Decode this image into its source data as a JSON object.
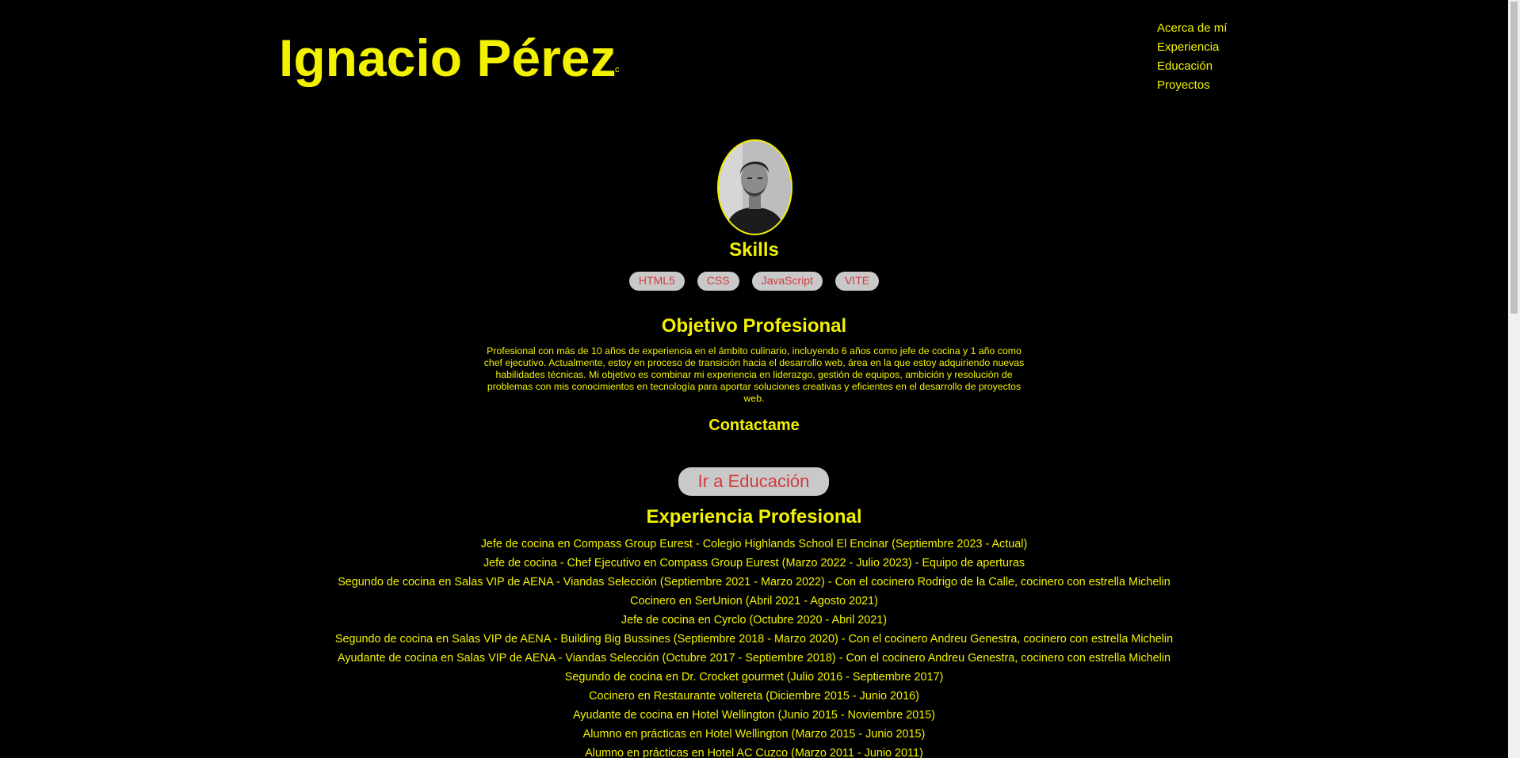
{
  "header": {
    "title": "Ignacio Pérez",
    "caret": "c"
  },
  "nav": {
    "items": [
      "Acerca de mí",
      "Experiencia",
      "Educación",
      "Proyectos"
    ]
  },
  "skills": {
    "title": "Skills",
    "items": [
      "HTML5",
      "CSS",
      "JavaScript",
      "VITE"
    ]
  },
  "objective": {
    "title": "Objetivo Profesional",
    "text": "Profesional con más de 10 años de experiencia en el ámbito culinario, incluyendo 6 años como jefe de cocina y 1 año como chef ejecutivo. Actualmente, estoy en proceso de transición hacia el desarrollo web, área en la que estoy adquiriendo nuevas habilidades técnicas. Mi objetivo es combinar mi experiencia en liderazgo, gestión de equipos, ambición y resolución de problemas con mis conocimientos en tecnología para aportar soluciones creativas y eficientes en el desarrollo de proyectos web."
  },
  "contact": {
    "title": "Contactame"
  },
  "education_button": {
    "label": "Ir a Educación"
  },
  "experience": {
    "title": "Experiencia Profesional",
    "items": [
      "Jefe de cocina en Compass Group Eurest - Colegio Highlands School El Encinar (Septiembre 2023 - Actual)",
      "Jefe de cocina - Chef Ejecutivo en Compass Group Eurest (Marzo 2022 - Julio 2023) - Equipo de aperturas",
      "Segundo de cocina en Salas VIP de AENA - Viandas Selección (Septiembre 2021 - Marzo 2022) - Con el cocinero Rodrigo de la Calle, cocinero con estrella Michelin",
      "Cocinero en SerUnion (Abril 2021 - Agosto 2021)",
      "Jefe de cocina en Cyrclo (Octubre 2020 - Abril 2021)",
      "Segundo de cocina en Salas VIP de AENA - Building Big Bussines (Septiembre 2018 - Marzo 2020) - Con el cocinero Andreu Genestra, cocinero con estrella Michelin",
      "Ayudante de cocina en Salas VIP de AENA - Viandas Selección (Octubre 2017 - Septiembre 2018) - Con el cocinero Andreu Genestra, cocinero con estrella Michelin",
      "Segundo de cocina en Dr. Crocket gourmet (Julio 2016 - Septiembre 2017)",
      "Cocinero en Restaurante voltereta (Diciembre 2015 - Junio 2016)",
      "Ayudante de cocina en Hotel Wellington (Junio 2015 - Noviembre 2015)",
      "Alumno en prácticas en Hotel Wellington (Marzo 2015 - Junio 2015)",
      "Alumno en prácticas en Hotel AC Cuzco (Marzo 2011 - Junio 2011)"
    ]
  },
  "colors": {
    "background": "#000000",
    "accent": "#f2f200",
    "pill_background": "#c9c9c9",
    "pill_text": "#d23b3b"
  }
}
